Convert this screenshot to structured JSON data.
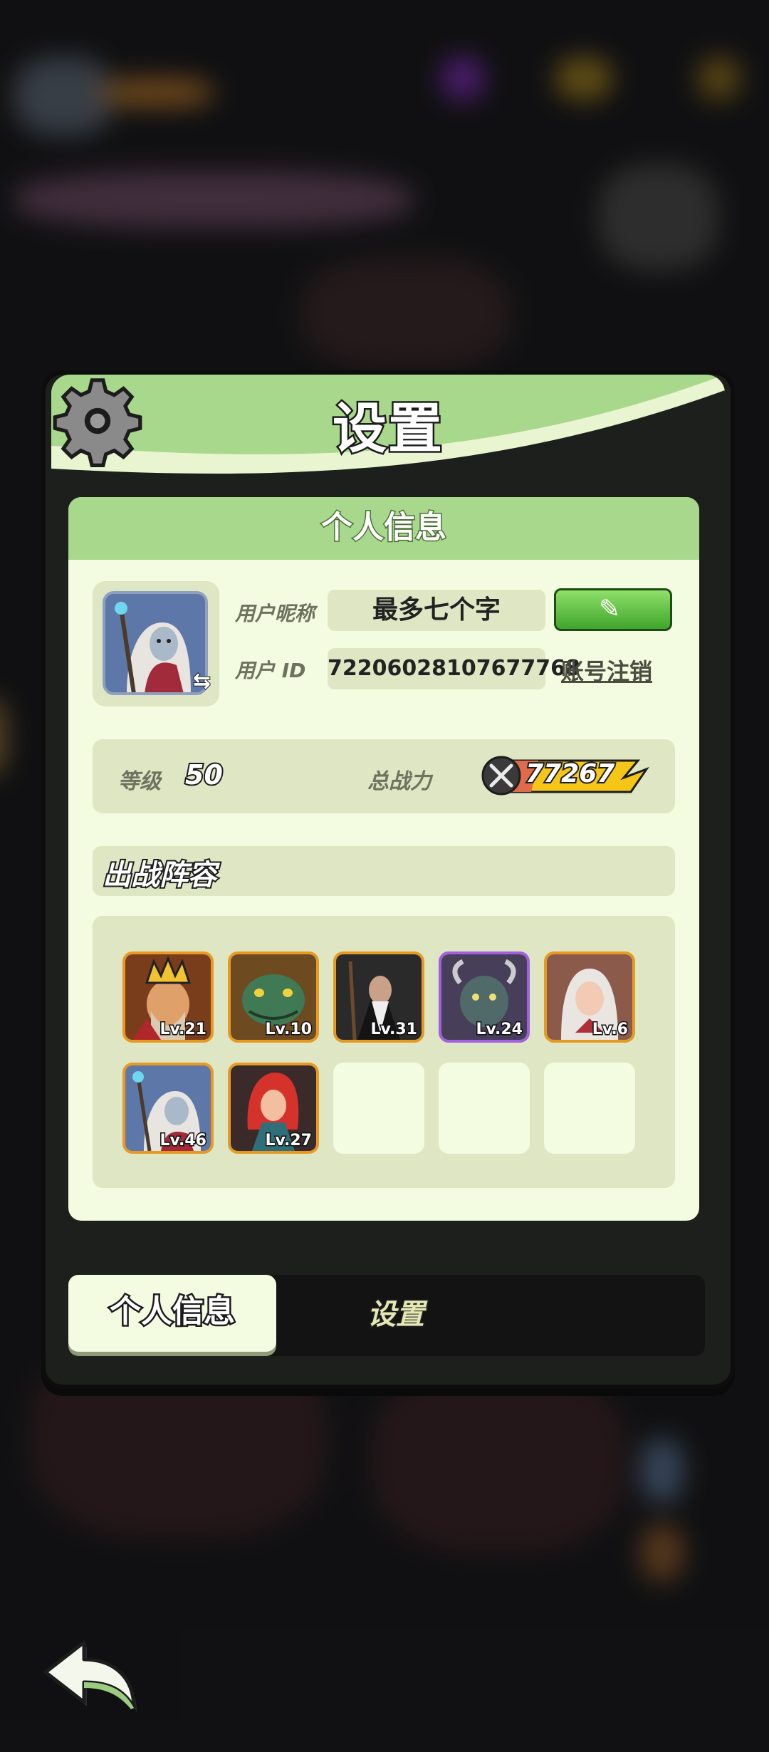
{
  "dialog": {
    "title": "设置",
    "icon": "gear-icon"
  },
  "profile": {
    "section_title": "个人信息",
    "nickname_label": "用户昵称",
    "nickname_value": "最多七个字",
    "id_label": "用户 ID",
    "id_value": "72206028107677768",
    "logout_label": "账号注销",
    "edit_icon": "pencil-icon",
    "swap_icon": "swap-arrows-icon"
  },
  "stats": {
    "level_label": "等级",
    "level_value": "50",
    "power_label": "总战力",
    "power_value": "77267",
    "power_icon": "crossed-swords-icon"
  },
  "lineup": {
    "title": "出战阵容",
    "heroes": [
      {
        "level": "Lv.21",
        "rarity": "orange",
        "portrait": "crowned-king-portrait"
      },
      {
        "level": "Lv.10",
        "rarity": "orange",
        "portrait": "green-lizard-portrait"
      },
      {
        "level": "Lv.31",
        "rarity": "orange",
        "portrait": "dark-sage-portrait"
      },
      {
        "level": "Lv.24",
        "rarity": "purple",
        "portrait": "horned-beast-portrait"
      },
      {
        "level": "Lv.6",
        "rarity": "orange",
        "portrait": "silver-hair-girl-portrait"
      },
      {
        "level": "Lv.46",
        "rarity": "orange",
        "portrait": "ghost-mage-portrait"
      },
      {
        "level": "Lv.27",
        "rarity": "orange",
        "portrait": "red-hair-warrior-portrait"
      }
    ],
    "empty_slots": 3
  },
  "tabs": {
    "active": "个人信息",
    "inactive": "设置"
  },
  "back_button": {
    "icon": "back-arrow-icon"
  },
  "colors": {
    "header_green": "#a8d88b",
    "panel_bg": "#f3fbe0",
    "slot_bg": "#dfe6c3",
    "edit_green": "#3fa52b",
    "rarity_orange": "#e69a22",
    "rarity_purple": "#a35fe0",
    "power_yellow": "#f5c518"
  }
}
